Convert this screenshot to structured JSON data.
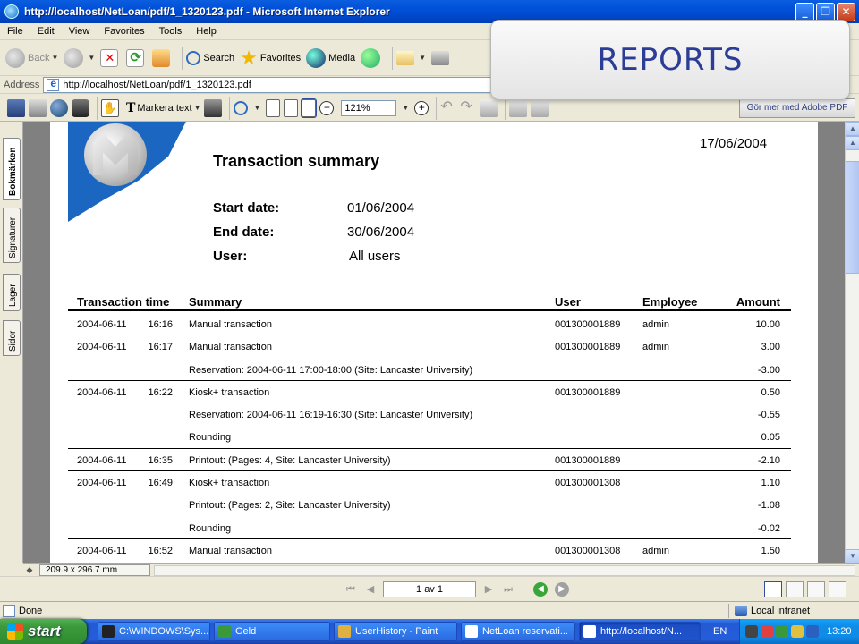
{
  "window": {
    "title": "http://localhost/NetLoan/pdf/1_1320123.pdf - Microsoft Internet Explorer",
    "minimize": "_",
    "maximize": "❐",
    "close": "✕"
  },
  "menu": [
    "File",
    "Edit",
    "View",
    "Favorites",
    "Tools",
    "Help"
  ],
  "toolbar": {
    "back_label": "Back",
    "search_label": "Search",
    "favorites_label": "Favorites",
    "media_label": "Media"
  },
  "address": {
    "label": "Address",
    "value": "http://localhost/NetLoan/pdf/1_1320123.pdf"
  },
  "overlay": {
    "text": "REPORTS"
  },
  "adobe_toolbar": {
    "select_text_label": "Markera text",
    "zoom_value": "121%",
    "get_more_label": "Gör mer med Adobe PDF"
  },
  "side_tabs": [
    "Bokmärken",
    "Signaturer",
    "Lager",
    "Sidor"
  ],
  "document": {
    "date": "17/06/2004",
    "title": "Transaction summary",
    "meta": [
      {
        "key": "Start date:",
        "value": "01/06/2004"
      },
      {
        "key": "End date:",
        "value": "30/06/2004"
      },
      {
        "key": "User:",
        "value": "All users"
      }
    ],
    "columns": {
      "time": "Transaction time",
      "summary": "Summary",
      "user": "User",
      "employee": "Employee",
      "amount": "Amount"
    },
    "rows": [
      {
        "date": "2004-06-11",
        "time": "16:16",
        "summary": "Manual transaction",
        "user": "001300001889",
        "employee": "admin",
        "amount": "10.00",
        "line_below": true
      },
      {
        "date": "2004-06-11",
        "time": "16:17",
        "summary": "Manual transaction",
        "user": "001300001889",
        "employee": "admin",
        "amount": "3.00",
        "line_below": false
      },
      {
        "date": "",
        "time": "",
        "summary": "Reservation: 2004-06-11 17:00-18:00 (Site: Lancaster University)",
        "user": "",
        "employee": "",
        "amount": "-3.00",
        "line_below": true
      },
      {
        "date": "2004-06-11",
        "time": "16:22",
        "summary": "Kiosk+ transaction",
        "user": "001300001889",
        "employee": "",
        "amount": "0.50",
        "line_below": false
      },
      {
        "date": "",
        "time": "",
        "summary": "Reservation: 2004-06-11 16:19-16:30 (Site: Lancaster University)",
        "user": "",
        "employee": "",
        "amount": "-0.55",
        "line_below": false
      },
      {
        "date": "",
        "time": "",
        "summary": "Rounding",
        "user": "",
        "employee": "",
        "amount": "0.05",
        "line_below": true
      },
      {
        "date": "2004-06-11",
        "time": "16:35",
        "summary": "Printout: (Pages: 4, Site: Lancaster University)",
        "user": "001300001889",
        "employee": "",
        "amount": "-2.10",
        "line_below": true
      },
      {
        "date": "2004-06-11",
        "time": "16:49",
        "summary": "Kiosk+ transaction",
        "user": "001300001308",
        "employee": "",
        "amount": "1.10",
        "line_below": false
      },
      {
        "date": "",
        "time": "",
        "summary": "Printout: (Pages: 2, Site: Lancaster University)",
        "user": "",
        "employee": "",
        "amount": "-1.08",
        "line_below": false
      },
      {
        "date": "",
        "time": "",
        "summary": "Rounding",
        "user": "",
        "employee": "",
        "amount": "-0.02",
        "line_below": true
      },
      {
        "date": "2004-06-11",
        "time": "16:52",
        "summary": "Manual transaction",
        "user": "001300001308",
        "employee": "admin",
        "amount": "1.50",
        "line_below": false
      }
    ]
  },
  "page_size": "209.9 x 296.7 mm",
  "page_nav": {
    "page_indicator": "1 av 1"
  },
  "status": {
    "text": "Done",
    "zone": "Local intranet"
  },
  "taskbar": {
    "start_label": "start",
    "tasks": [
      {
        "label": "C:\\WINDOWS\\Sys...",
        "icon_color": "#222222",
        "active": false
      },
      {
        "label": "Geld",
        "icon_color": "#3a9a3a",
        "active": false
      },
      {
        "label": "UserHistory - Paint",
        "icon_color": "#e0b040",
        "active": false
      },
      {
        "label": "NetLoan reservati...",
        "icon_color": "#ffffff",
        "active": false
      },
      {
        "label": "http://localhost/N...",
        "icon_color": "#ffffff",
        "active": true
      }
    ],
    "language": "EN",
    "clock": "13:20"
  },
  "colors": {
    "overlay_text": "#2c3d96",
    "logo_blue": "#1a66c0"
  }
}
